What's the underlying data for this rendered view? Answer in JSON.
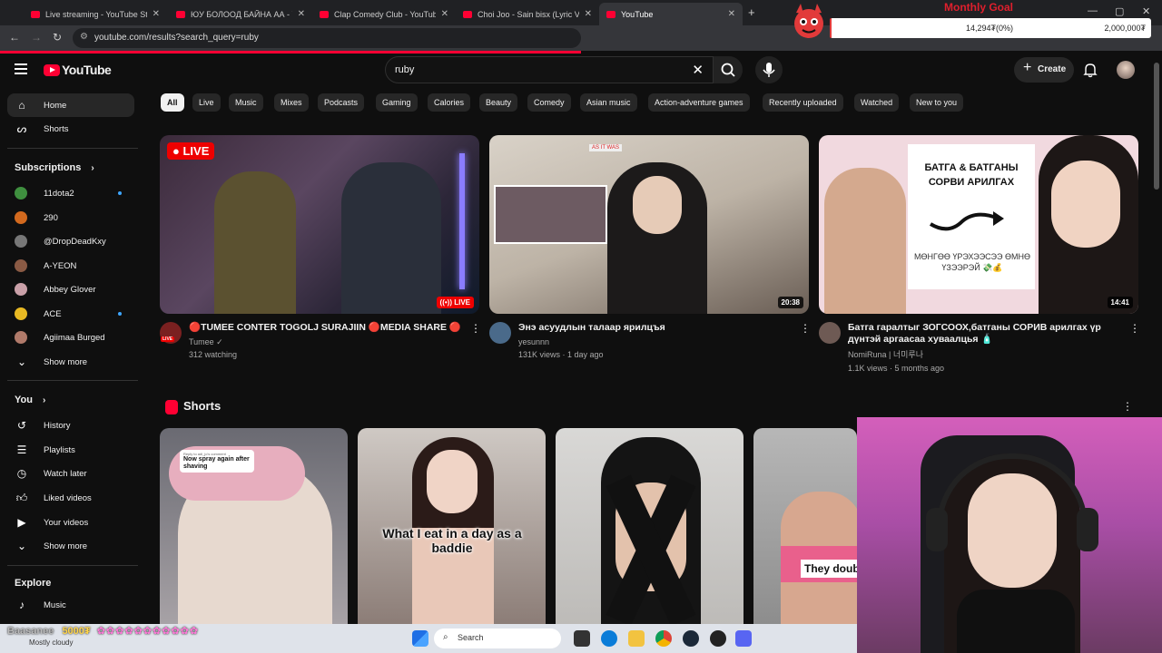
{
  "browser": {
    "tabs": [
      {
        "title": "Live streaming - YouTube Studio"
      },
      {
        "title": "ЮУ БОЛООД БАЙНА АА - YouTube"
      },
      {
        "title": "Clap Comedy Club - YouTube"
      },
      {
        "title": "Choi Joo - Sain bisx (Lyric Video)"
      },
      {
        "title": "YouTube"
      }
    ],
    "new_tab": "+",
    "url": "youtube.com/results?search_query=ruby"
  },
  "goal": {
    "title": "Monthly Goal",
    "current": "14,294₮(0%)",
    "target": "2,000,000₮",
    "progress": 0.007
  },
  "header": {
    "logo": "YouTube",
    "search_value": "ruby",
    "create_label": "Create"
  },
  "sidebar": {
    "main": [
      {
        "label": "Home",
        "icon": "home-icon"
      },
      {
        "label": "Shorts",
        "icon": "shorts-icon"
      }
    ],
    "subscriptions_title": "Subscriptions",
    "subscriptions": [
      {
        "label": "11dota2",
        "dot": true
      },
      {
        "label": "290",
        "dot": false
      },
      {
        "label": "@DropDeadKxy",
        "dot": false
      },
      {
        "label": "A-YEON",
        "dot": false
      },
      {
        "label": "Abbey Glover",
        "dot": false
      },
      {
        "label": "ACE",
        "dot": true
      },
      {
        "label": "Agiimaa Burged",
        "dot": false
      }
    ],
    "show_more": "Show more",
    "you_title": "You",
    "you_items": [
      {
        "label": "History",
        "icon": "history-icon"
      },
      {
        "label": "Playlists",
        "icon": "playlists-icon"
      },
      {
        "label": "Watch later",
        "icon": "watch-later-icon"
      },
      {
        "label": "Liked videos",
        "icon": "liked-icon"
      },
      {
        "label": "Your videos",
        "icon": "your-videos-icon"
      }
    ],
    "show_more_2": "Show more",
    "explore_title": "Explore",
    "explore_items": [
      {
        "label": "Music",
        "icon": "music-icon"
      }
    ]
  },
  "chips": [
    "All",
    "Live",
    "Music",
    "Mixes",
    "Podcasts",
    "Gaming",
    "Calories",
    "Beauty",
    "Comedy",
    "Asian music",
    "Action-adventure games",
    "Recently uploaded",
    "Watched",
    "New to you"
  ],
  "videos": [
    {
      "badge": "LIVE",
      "thumb_badge": "LIVE",
      "title": "🔴TUMEE CONTER TOGOLJ SURAJIIN 🔴MEDIA SHARE 🔴",
      "channel": "Tumee ✓",
      "meta": "312 watching",
      "avatar_badge": "LIVE"
    },
    {
      "duration": "20:38",
      "title": "Энэ асуудлын талаар ярилцъя",
      "channel": "yesunnn",
      "meta": "131K views · 1 day ago",
      "thumb_sign": "AS IT WAS"
    },
    {
      "duration": "14:41",
      "title": "Батга гаралтыг ЗОГСООХ,батганы СОРИВ арилгах үр дүнтэй аргаасаа хуваалцья 🧴",
      "channel": "NomiRuna | 너미루나",
      "meta": "1.1K views · 5 months ago",
      "thumb_text_1": "БАТГА & БАТГАНЫ СОРВИ АРИЛГАХ",
      "thumb_text_2": "МӨНГӨӨ ҮРЭХЭЭСЭЭ ӨМНӨ ҮЗЭЭРЭЙ 💸💰"
    }
  ],
  "shorts": {
    "title": "Shorts",
    "items": [
      {
        "reply": "Reply to adi_jo's comment",
        "reply_text": "Now spray again after shaving"
      },
      {
        "caption": "What I eat in a day as a baddie"
      },
      {
        "caption": ""
      },
      {
        "caption": "They doubt"
      }
    ]
  },
  "taskbar": {
    "donation_user": "Baasanee",
    "donation_amount": "5000₮",
    "weather": "Mostly cloudy",
    "search": "Search"
  },
  "colors": {
    "bg": "#0f0f0f",
    "accent": "#ff0033",
    "chip": "#272727"
  }
}
